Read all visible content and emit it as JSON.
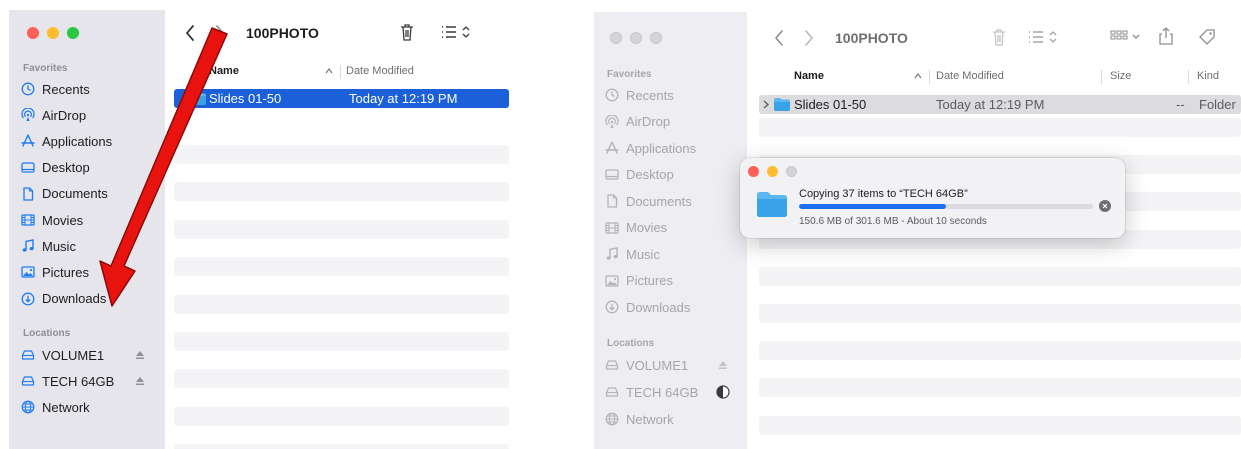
{
  "colors": {
    "selection": "#1b5fd9",
    "sidebar_icon": "#1f7bf6",
    "annotation_arrow": "#e8130f",
    "progress": "#1d6ff2",
    "folder": "#3aa3e8"
  },
  "left": {
    "folder_title": "100PHOTO",
    "sidebar": {
      "favorites_header": "Favorites",
      "favorites": [
        {
          "label": "Recents",
          "icon": "clock-icon"
        },
        {
          "label": "AirDrop",
          "icon": "airdrop-icon"
        },
        {
          "label": "Applications",
          "icon": "applications-icon"
        },
        {
          "label": "Desktop",
          "icon": "desktop-icon"
        },
        {
          "label": "Documents",
          "icon": "document-icon"
        },
        {
          "label": "Movies",
          "icon": "film-icon"
        },
        {
          "label": "Music",
          "icon": "music-note-icon"
        },
        {
          "label": "Pictures",
          "icon": "photo-icon"
        },
        {
          "label": "Downloads",
          "icon": "download-icon"
        }
      ],
      "locations_header": "Locations",
      "locations": [
        {
          "label": "VOLUME1",
          "icon": "drive-icon",
          "eject": true
        },
        {
          "label": "TECH 64GB",
          "icon": "drive-icon",
          "eject": true
        },
        {
          "label": "Network",
          "icon": "globe-icon",
          "eject": false
        }
      ]
    },
    "columns": {
      "name": "Name",
      "date": "Date Modified"
    },
    "rows": [
      {
        "name": "Slides 01-50",
        "date": "Today at 12:19 PM",
        "selected": true
      }
    ]
  },
  "right": {
    "folder_title": "100PHOTO",
    "sidebar": {
      "favorites_header": "Favorites",
      "favorites": [
        {
          "label": "Recents",
          "icon": "clock-icon"
        },
        {
          "label": "AirDrop",
          "icon": "airdrop-icon"
        },
        {
          "label": "Applications",
          "icon": "applications-icon"
        },
        {
          "label": "Desktop",
          "icon": "desktop-icon"
        },
        {
          "label": "Documents",
          "icon": "document-icon"
        },
        {
          "label": "Movies",
          "icon": "film-icon"
        },
        {
          "label": "Music",
          "icon": "music-note-icon"
        },
        {
          "label": "Pictures",
          "icon": "photo-icon"
        },
        {
          "label": "Downloads",
          "icon": "download-icon"
        }
      ],
      "locations_header": "Locations",
      "locations": [
        {
          "label": "VOLUME1",
          "icon": "drive-icon",
          "status": "eject"
        },
        {
          "label": "TECH 64GB",
          "icon": "drive-icon",
          "status": "progress-pie"
        },
        {
          "label": "Network",
          "icon": "globe-icon",
          "status": ""
        }
      ]
    },
    "columns": {
      "name": "Name",
      "date": "Date Modified",
      "size": "Size",
      "kind": "Kind"
    },
    "rows": [
      {
        "name": "Slides 01-50",
        "date": "Today at 12:19 PM",
        "size": "--",
        "kind": "Folder"
      }
    ],
    "copy_dialog": {
      "title": "Copying 37 items to “TECH 64GB”",
      "detail": "150.6 MB of 301.6 MB - About 10 seconds",
      "progress_percent": 50
    }
  }
}
